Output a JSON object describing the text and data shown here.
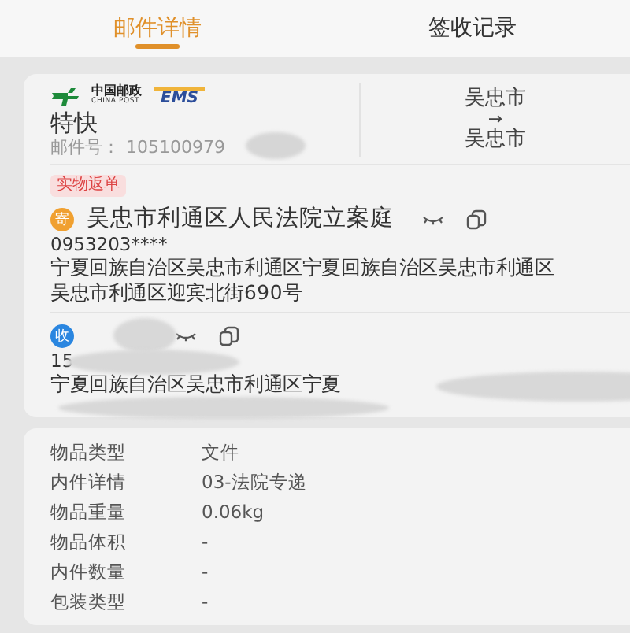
{
  "tabs": [
    {
      "label": "邮件详情",
      "selected": true
    },
    {
      "label": "签收记录",
      "selected": false
    }
  ],
  "mail": {
    "logo": {
      "cn": "中国邮政",
      "en": "CHINA POST",
      "ems": "EMS"
    },
    "service": "特快",
    "number_label": "邮件号：",
    "number": "105100979",
    "number_redacted": true,
    "origin": "吴忠市",
    "arrow": "→",
    "destination": "吴忠市",
    "tag": "实物返单"
  },
  "parties": [
    {
      "kind": "sender",
      "badge": "寄",
      "name": "吴忠市利通区人民法院立案庭",
      "phone": "0953203****",
      "address_lines": [
        "宁夏回族自治区吴忠市利通区宁夏回族自治区吴忠市利通区",
        "吴忠市利通区迎宾北街690号"
      ],
      "redacted": false
    },
    {
      "kind": "receiver",
      "badge": "收",
      "phone": "15",
      "address_lines": [
        "宁夏回族自治区吴忠市利通区宁夏"
      ],
      "redacted": true
    }
  ],
  "details": [
    {
      "label": "物品类型",
      "value": "文件"
    },
    {
      "label": "内件详情",
      "value": "03-法院专递"
    },
    {
      "label": "物品重量",
      "value": "0.06kg"
    },
    {
      "label": "物品体积",
      "value": "-"
    },
    {
      "label": "内件数量",
      "value": "-"
    },
    {
      "label": "包装类型",
      "value": "-"
    }
  ]
}
